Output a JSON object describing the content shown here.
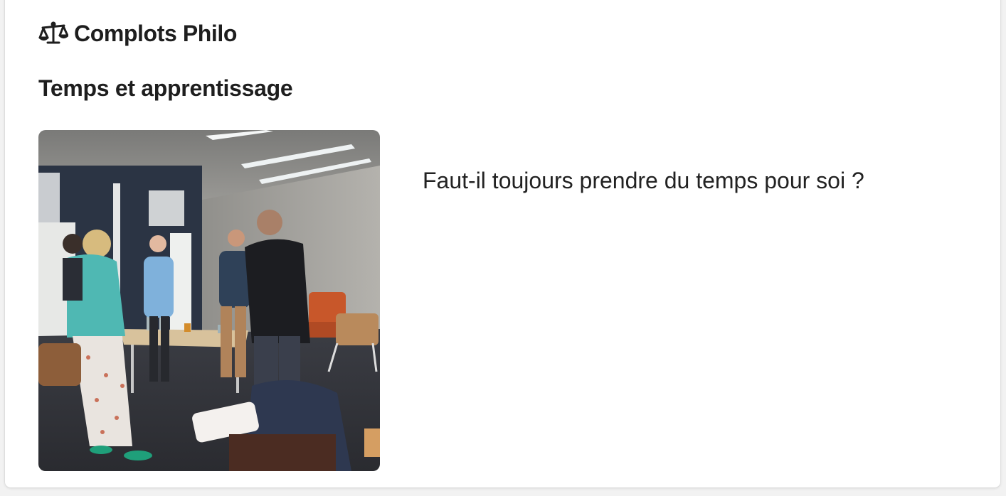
{
  "brand": {
    "icon": "scales-icon",
    "name": "Complots Philo"
  },
  "section": {
    "title": "Temps et apprentissage"
  },
  "article": {
    "image_icon": "group-discussion-photo",
    "question": "Faut-il toujours prendre du temps pour soi ?"
  },
  "colors": {
    "page_background": "#f2f2f2",
    "card_background": "#ffffff",
    "text": "#1e1e1e"
  }
}
